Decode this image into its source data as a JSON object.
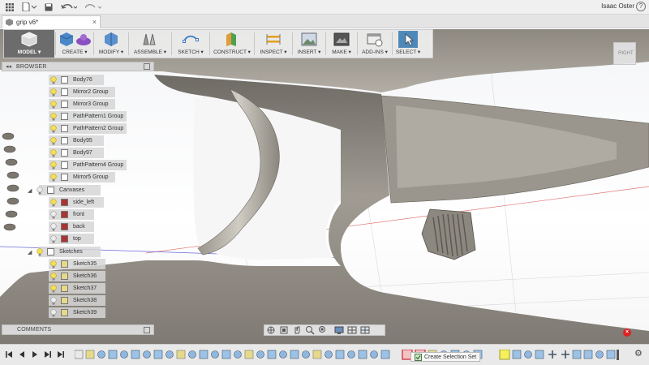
{
  "titlebar": {
    "user_name": "Isaac Oster",
    "help_label": "?"
  },
  "document_tab": {
    "title": "grip v6*",
    "close_glyph": "×"
  },
  "toolbar": {
    "items": [
      {
        "label": "MODEL ▾",
        "icon": "cube-icon"
      },
      {
        "label": "CREATE ▾",
        "icon": "create-icon"
      },
      {
        "label": "MODIFY ▾",
        "icon": "modify-icon"
      },
      {
        "label": "ASSEMBLE ▾",
        "icon": "assemble-icon"
      },
      {
        "label": "SKETCH ▾",
        "icon": "sketch-icon"
      },
      {
        "label": "CONSTRUCT ▾",
        "icon": "construct-icon"
      },
      {
        "label": "INSPECT ▾",
        "icon": "inspect-icon"
      },
      {
        "label": "INSERT ▾",
        "icon": "insert-icon"
      },
      {
        "label": "MAKE ▾",
        "icon": "make-icon"
      },
      {
        "label": "ADD-INS ▾",
        "icon": "add-ins-icon"
      },
      {
        "label": "SELECT ▾",
        "icon": "select-icon"
      }
    ]
  },
  "browser": {
    "header": "BROWSER",
    "items": [
      {
        "label": "Body76"
      },
      {
        "label": "Mirror2 Group"
      },
      {
        "label": "Mirror3 Group"
      },
      {
        "label": "PathPattern1 Group"
      },
      {
        "label": "PathPattern2 Group"
      },
      {
        "label": "Body95"
      },
      {
        "label": "Body97"
      },
      {
        "label": "PathPattern4 Group"
      },
      {
        "label": "Mirror5 Group"
      },
      {
        "label": "Canvases"
      },
      {
        "label": "side_left"
      },
      {
        "label": "front"
      },
      {
        "label": "back"
      },
      {
        "label": "top"
      },
      {
        "label": "Sketches"
      },
      {
        "label": "Sketch35"
      },
      {
        "label": "Sketch36"
      },
      {
        "label": "Sketch37"
      },
      {
        "label": "Sketch38"
      },
      {
        "label": "Sketch39"
      }
    ]
  },
  "comments": {
    "header": "COMMENTS"
  },
  "viewcube": {
    "face_label": "RIGHT"
  },
  "timeline": {
    "tooltip": "Create Selection Set"
  },
  "colors": {
    "accent": "#5a8bb8",
    "model_bg": "#6c6c6c",
    "error": "#dd2222"
  }
}
